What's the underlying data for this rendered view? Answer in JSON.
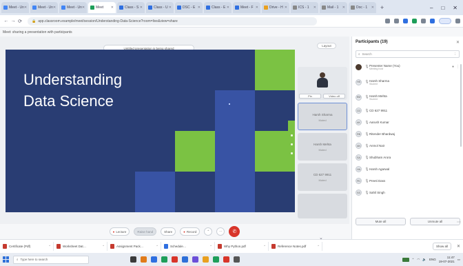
{
  "browser": {
    "tabs": [
      {
        "label": "Meet - Un",
        "color": "#4285f4",
        "active": false
      },
      {
        "label": "Meet - Un",
        "color": "#4285f4",
        "active": false
      },
      {
        "label": "Meet - Un",
        "color": "#4285f4",
        "active": false
      },
      {
        "label": "Meet",
        "color": "#1e9e5a",
        "active": true
      },
      {
        "label": "Class - S",
        "color": "#2f6fe0",
        "active": false
      },
      {
        "label": "Class - U",
        "color": "#2f6fe0",
        "active": false
      },
      {
        "label": "DSC - E",
        "color": "#2f6fe0",
        "active": false
      },
      {
        "label": "Class - E",
        "color": "#2f6fe0",
        "active": false
      },
      {
        "label": "Meet - F",
        "color": "#2f6fe0",
        "active": false
      },
      {
        "label": "Drive - H",
        "color": "#e9a020",
        "active": false
      },
      {
        "label": "ICS - 1",
        "color": "#888888",
        "active": false
      },
      {
        "label": "Mail - 1",
        "color": "#888888",
        "active": false
      },
      {
        "label": "Doc - 1",
        "color": "#888888",
        "active": false
      }
    ],
    "new_tab": "+",
    "window_controls": [
      "–",
      "□",
      "✕"
    ],
    "url": "app.classroom.example/meet/session/Understanding-Data-Science?room=live&view=share",
    "sub_line": "Meet: sharing a presentation with participants"
  },
  "stage": {
    "share_banner": "Untitled presentation is being shared",
    "pill_label": "Layout",
    "slide": {
      "title_line1": "Understanding",
      "title_line2": "Data Science"
    },
    "tiles": [
      {
        "name": "Presenter",
        "sub": "",
        "tag_left": "Pin",
        "tag_right": "Video off"
      },
      {
        "name": "Harsh Sharma",
        "sub": "Muted"
      },
      {
        "name": "Harsh Mehta",
        "sub": "Muted"
      },
      {
        "name": "CD 627 9911",
        "sub": "Muted"
      }
    ],
    "more_label": "⌄"
  },
  "controls": {
    "buttons": [
      {
        "label": "Lecture",
        "style": "red"
      },
      {
        "label": "Raise hand",
        "style": "grey"
      },
      {
        "label": "Share",
        "style": "plain"
      },
      {
        "label": "Record",
        "style": "red"
      },
      {
        "label": "⌃",
        "style": "circle"
      },
      {
        "label": "⋯",
        "style": "circle"
      },
      {
        "label": "✆",
        "style": "end"
      }
    ],
    "right": [
      {
        "label": "Participants",
        "icon": "👥"
      },
      {
        "label": "Chat",
        "icon": "💬"
      }
    ]
  },
  "panel": {
    "title": "Participants (19)",
    "close": "✕",
    "search_placeholder": "Search",
    "participants": [
      {
        "initials": "",
        "name": "Presenter Name (You)",
        "sub": "Meeting host",
        "tall": true,
        "photo": true
      },
      {
        "initials": "HS",
        "name": "Harsh Sharma",
        "sub": "Student",
        "tall": true
      },
      {
        "initials": "HM",
        "name": "Harsh Mehta",
        "sub": "Student",
        "tall": true
      },
      {
        "initials": "CD",
        "name": "CD 627 9911",
        "sub": ""
      },
      {
        "initials": "AK",
        "name": "Aarush Kumar",
        "sub": ""
      },
      {
        "initials": "RB",
        "name": "Ritender Bhardwaj",
        "sub": ""
      },
      {
        "initials": "AN",
        "name": "Anmol Nair",
        "sub": ""
      },
      {
        "initials": "SA",
        "name": "Shubham Arora",
        "sub": ""
      },
      {
        "initials": "HA",
        "name": "Harsh Agarwal",
        "sub": ""
      },
      {
        "initials": "PD",
        "name": "Preeti Dass",
        "sub": ""
      },
      {
        "initials": "SS",
        "name": "Sahil Singh",
        "sub": ""
      }
    ],
    "mute_all": "Mute all",
    "unmute_all": "Unmute all",
    "more": "⋯"
  },
  "downloads": {
    "items": [
      {
        "name": "Certificate (Pdf)",
        "type": "pdf"
      },
      {
        "name": "Worksheet Dat…",
        "type": "pdf"
      },
      {
        "name": "Assignment Pack…",
        "type": "pdf"
      },
      {
        "name": "Schedule…",
        "type": "doc"
      },
      {
        "name": "Why Python.pdf",
        "type": "pdf"
      },
      {
        "name": "Reference Notes.pdf",
        "type": "pdf"
      }
    ],
    "show_all": "Show all",
    "close": "✕"
  },
  "taskbar": {
    "search_placeholder": "Type here to search",
    "apps": [
      "#3b3b3b",
      "#e07b1a",
      "#2f6fe0",
      "#1e9e5a",
      "#d8352a",
      "#2d6fd8",
      "#6b4fd8",
      "#e9a020",
      "#1e9e5a",
      "#d8352a",
      "#555555"
    ],
    "tray_text": "ENG",
    "time": "11:47",
    "date": "19-07-2021"
  }
}
